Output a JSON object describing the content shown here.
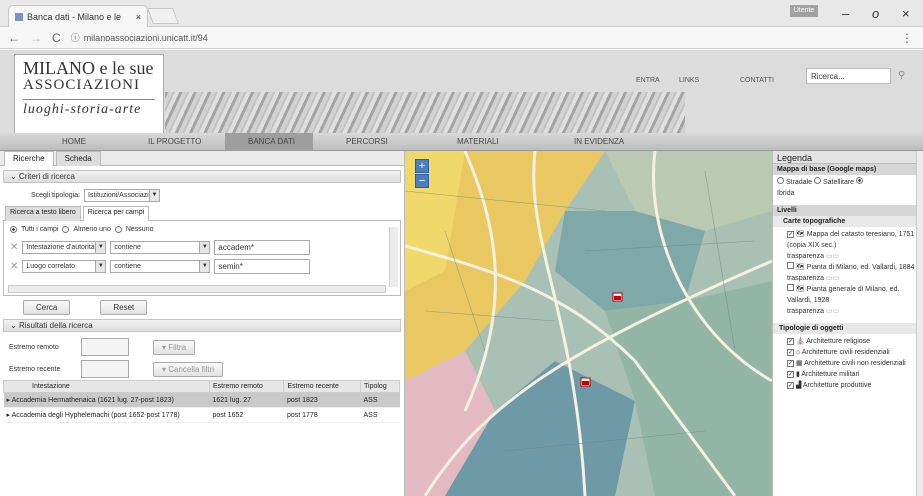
{
  "browser": {
    "tab_title": "Banca dati - Milano e le",
    "tab_close": "×",
    "url": "milanoassociazioni.unicatt.it/94",
    "window_min": "–",
    "window_max": "o",
    "window_close": "×",
    "profile_badge": "Utente"
  },
  "header": {
    "logo_line1": "MILANO e le sue",
    "logo_line2": "ASSOCIAZIONI",
    "logo_line3": "luoghi-storia-arte",
    "top_links": [
      "ENTRA",
      "LINKS",
      "CONTATTI"
    ],
    "search_placeholder": "Ricerca..."
  },
  "nav": {
    "items": [
      "HOME",
      "IL PROGETTO",
      "BANCA DATI",
      "PERCORSI",
      "MATERIALI",
      "IN EVIDENZA"
    ],
    "active": "BANCA DATI"
  },
  "left": {
    "tabs": [
      "Ricerche",
      "Scheda"
    ],
    "criteria_title": "Criteri di ricerca",
    "tipologia_label": "Scegli tipologia:",
    "tipologia_value": "Istituzioni/Associazioni",
    "subtabs": [
      "Ricerca a testo libero",
      "Ricerca per campi"
    ],
    "match_options": [
      "Tutti i campi",
      "Almeno uno",
      "Nessuno"
    ],
    "rows": [
      {
        "field": "Intestazione d'autorità",
        "op": "contiene",
        "value": "accadem*"
      },
      {
        "field": "Luogo correlato",
        "op": "contiene",
        "value": "semin*"
      }
    ],
    "cerca": "Cerca",
    "reset": "Reset",
    "results_title": "Risultati della ricerca",
    "extremo_remoto": "Estremo remoto",
    "extremo_recente": "Estremo recente",
    "filtra": "Filtra",
    "cancella": "Cancella filtri",
    "table_headers": [
      "Intestazione",
      "Estremo remoto",
      "Estremo recente",
      "Tipolog"
    ],
    "results": [
      [
        "Accademia Hermathenaica (1621 lug. 27-post 1823)",
        "1621 lug. 27",
        "post 1823",
        "ASS"
      ],
      [
        "Accademia degli Hyphelemachi (post 1652-post 1778)",
        "post 1652",
        "post 1778",
        "ASS"
      ]
    ]
  },
  "legend": {
    "title": "Legenda",
    "base_map_title": "Mappa di base (Google maps)",
    "base_options": [
      "Stradale",
      "Satellitare",
      "Ibrida"
    ],
    "layers_title": "Livelli",
    "carte_title": "Carte topografiche",
    "carte": [
      {
        "name": "Mappa del catasto teresiano, 1751 (copia XIX sec.)",
        "transp": "trasparenza"
      },
      {
        "name": "Pianta di Milano, ed. Vallardi, 1884",
        "transp": "trasparenza"
      },
      {
        "name": "Pianta generale di Milano, ed. Vallardi, 1928",
        "transp": "trasparenza"
      }
    ],
    "tipologie_title": "Tipologie di oggetti",
    "tipologie": [
      "Architetture religiose",
      "Architetture civili residenziali",
      "Architetture civili non residenziali",
      "Architetture militari",
      "Architetture produttive"
    ]
  },
  "map": {
    "zoom_in": "+",
    "zoom_out": "−"
  }
}
